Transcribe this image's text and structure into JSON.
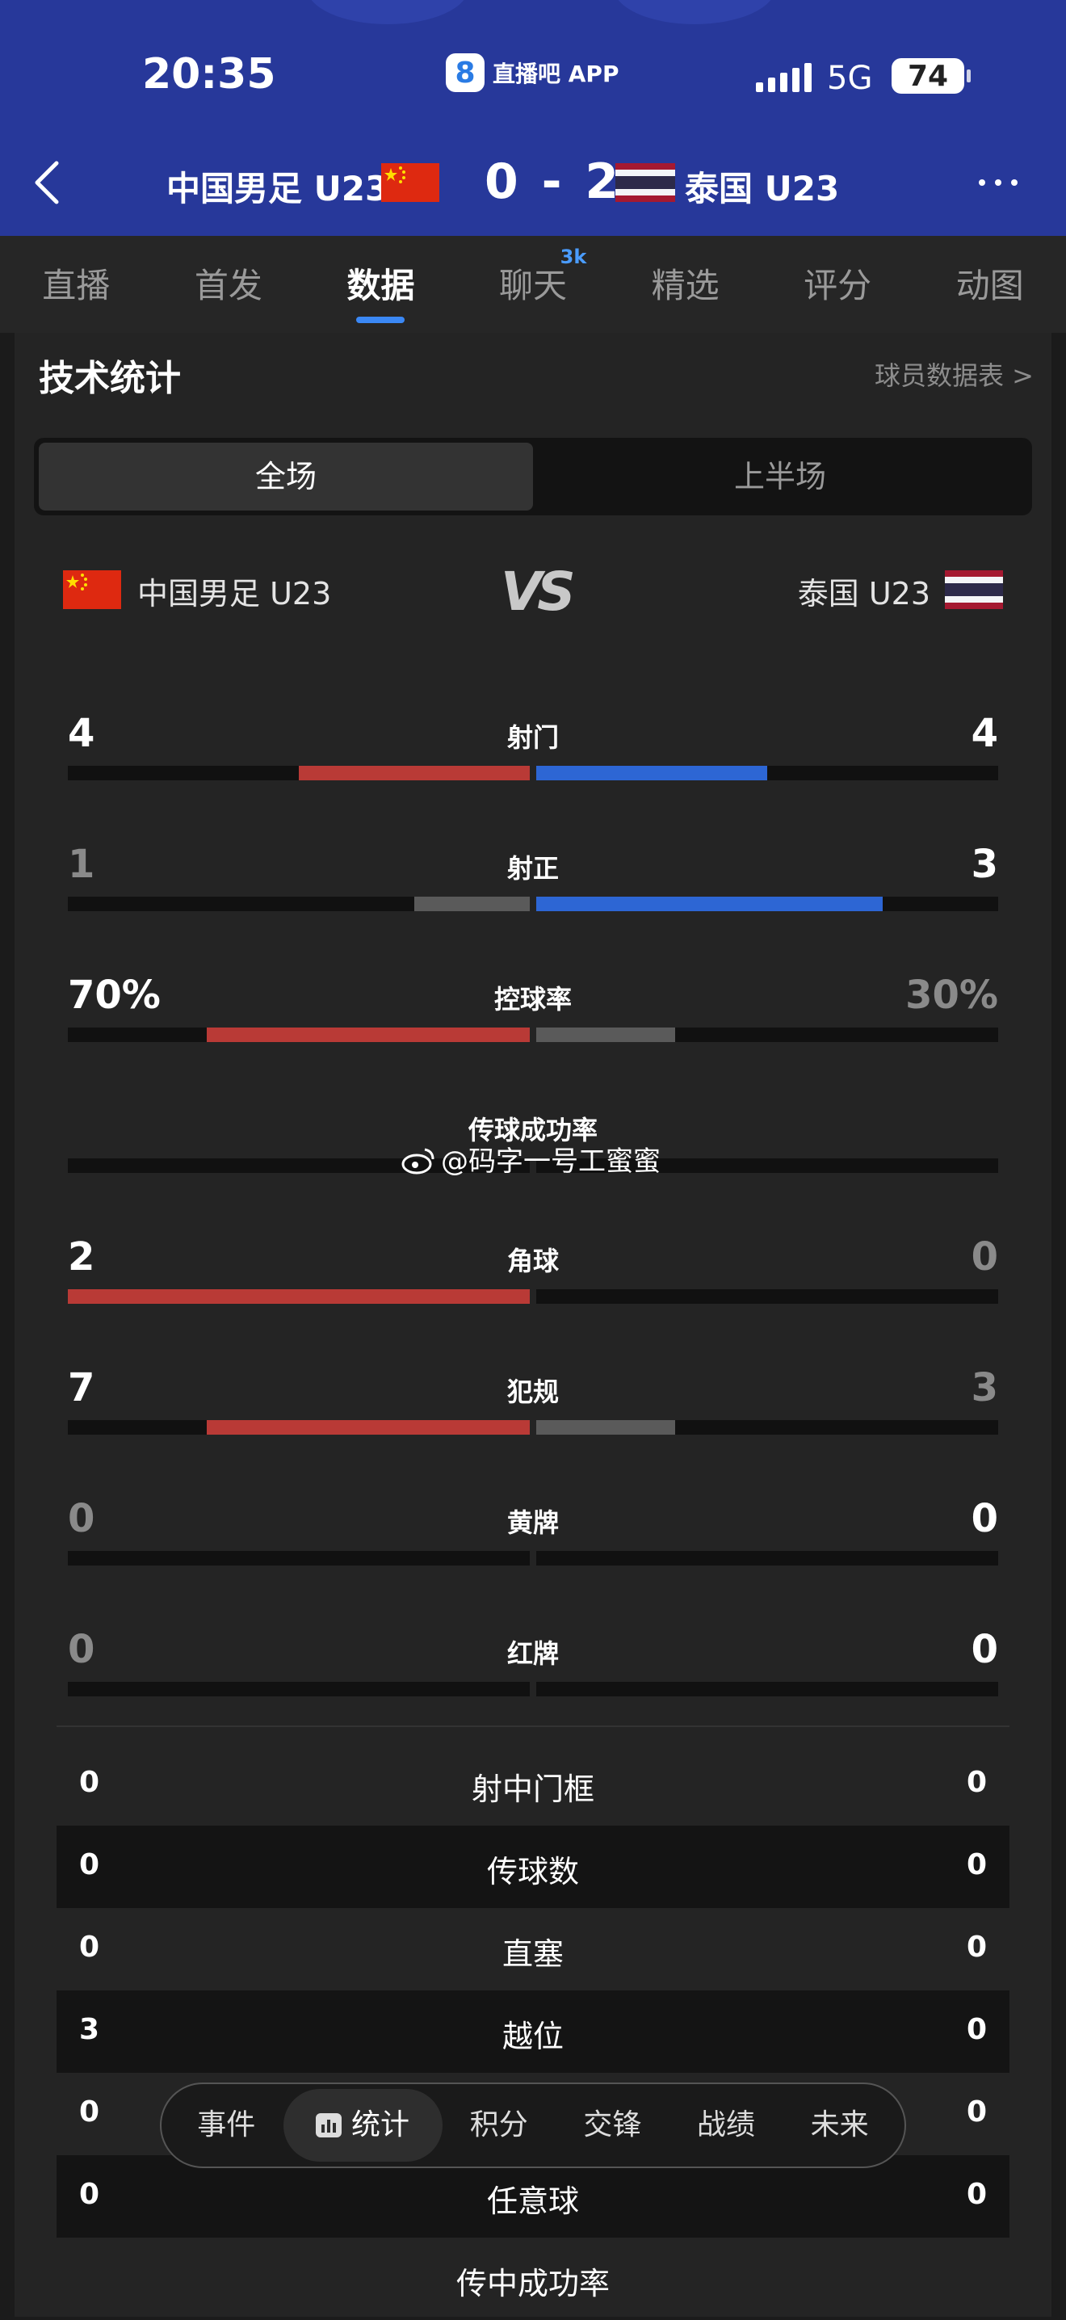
{
  "status_bar": {
    "time": "20:35",
    "app_label": "直播吧 APP",
    "app_icon_text": "8",
    "network": "5G",
    "battery": "74"
  },
  "match": {
    "home": "中国男足 U23",
    "away": "泰国 U23",
    "score": "0 - 2"
  },
  "tabs": [
    {
      "label": "直播"
    },
    {
      "label": "首发"
    },
    {
      "label": "数据",
      "active": true
    },
    {
      "label": "聊天",
      "badge": "3k"
    },
    {
      "label": "精选"
    },
    {
      "label": "评分"
    },
    {
      "label": "动图"
    }
  ],
  "section": {
    "title": "技术统计",
    "player_link": "球员数据表 >"
  },
  "segment": {
    "full": "全场",
    "first_half": "上半场"
  },
  "vs": {
    "home": "中国男足 U23",
    "logo": "VS",
    "away": "泰国 U23"
  },
  "colors": {
    "home": "#b93a36",
    "away": "#2d66d4",
    "neutral": "#5a5a5a",
    "header": "#27389a"
  },
  "bars": [
    {
      "label": "射门",
      "home": "4",
      "away": "4",
      "home_share": 0.5,
      "away_share": 0.5,
      "home_color": "home",
      "away_color": "away",
      "home_dim": false,
      "away_dim": false
    },
    {
      "label": "射正",
      "home": "1",
      "away": "3",
      "home_share": 0.25,
      "away_share": 0.75,
      "home_color": "neutral",
      "away_color": "away",
      "home_dim": true,
      "away_dim": false
    },
    {
      "label": "控球率",
      "home": "70%",
      "away": "30%",
      "home_share": 0.7,
      "away_share": 0.3,
      "home_color": "home",
      "away_color": "neutral",
      "home_dim": false,
      "away_dim": true
    },
    {
      "label": "传球成功率",
      "home": "",
      "away": "",
      "home_share": 0,
      "away_share": 0,
      "home_color": "home",
      "away_color": "away",
      "home_dim": false,
      "away_dim": false
    },
    {
      "label": "角球",
      "home": "2",
      "away": "0",
      "home_share": 1,
      "away_share": 0,
      "home_color": "home",
      "away_color": "away",
      "home_dim": false,
      "away_dim": true
    },
    {
      "label": "犯规",
      "home": "7",
      "away": "3",
      "home_share": 0.7,
      "away_share": 0.3,
      "home_color": "home",
      "away_color": "neutral",
      "home_dim": false,
      "away_dim": true
    },
    {
      "label": "黄牌",
      "home": "0",
      "away": "0",
      "home_share": 0,
      "away_share": 0,
      "home_color": "home",
      "away_color": "away",
      "home_dim": true,
      "away_dim": false
    },
    {
      "label": "红牌",
      "home": "0",
      "away": "0",
      "home_share": 0,
      "away_share": 0,
      "home_color": "home",
      "away_color": "away",
      "home_dim": true,
      "away_dim": false
    }
  ],
  "table": [
    {
      "label": "射中门框",
      "home": "0",
      "away": "0"
    },
    {
      "label": "传球数",
      "home": "0",
      "away": "0"
    },
    {
      "label": "直塞",
      "home": "0",
      "away": "0"
    },
    {
      "label": "越位",
      "home": "3",
      "away": "0"
    },
    {
      "label": "",
      "home": "0",
      "away": "0"
    },
    {
      "label": "任意球",
      "home": "0",
      "away": "0"
    },
    {
      "label": "传中成功率",
      "home": "",
      "away": ""
    }
  ],
  "watermark": "@码字一号工蜜蜜",
  "bottom_nav": [
    {
      "label": "事件"
    },
    {
      "label": "统计",
      "active": true
    },
    {
      "label": "积分"
    },
    {
      "label": "交锋"
    },
    {
      "label": "战绩"
    },
    {
      "label": "未来"
    }
  ]
}
